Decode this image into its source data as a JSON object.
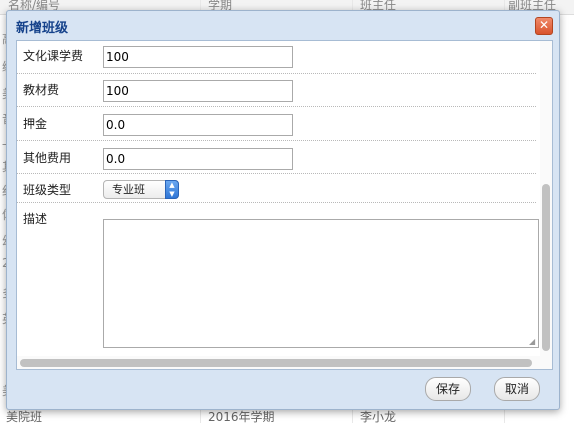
{
  "background": {
    "columns": [
      "名称/编号",
      "学期",
      "班主任",
      "副班主任"
    ],
    "left_glyphs": [
      "高",
      "编",
      "美",
      "音",
      "一",
      "其",
      "纪",
      "体",
      "幼",
      "2",
      "多",
      "英",
      "美"
    ],
    "bottom_row": [
      "美院班",
      "2016年学期",
      "李小龙"
    ]
  },
  "dialog": {
    "title": "新增班级",
    "close_icon": "close-icon",
    "fields": [
      {
        "label": "文化课学费",
        "value": "100"
      },
      {
        "label": "教材费",
        "value": "100"
      },
      {
        "label": "押金",
        "value": "0.0"
      },
      {
        "label": "其他费用",
        "value": "0.0"
      }
    ],
    "class_type": {
      "label": "班级类型",
      "selected": "专业班"
    },
    "description": {
      "label": "描述",
      "value": ""
    },
    "save_label": "保存",
    "cancel_label": "取消"
  },
  "colors": {
    "dialog_frame": "#d7e4f3",
    "title_text": "#15428b",
    "close_button": "#d9532c",
    "select_accent": "#2f76d6"
  }
}
